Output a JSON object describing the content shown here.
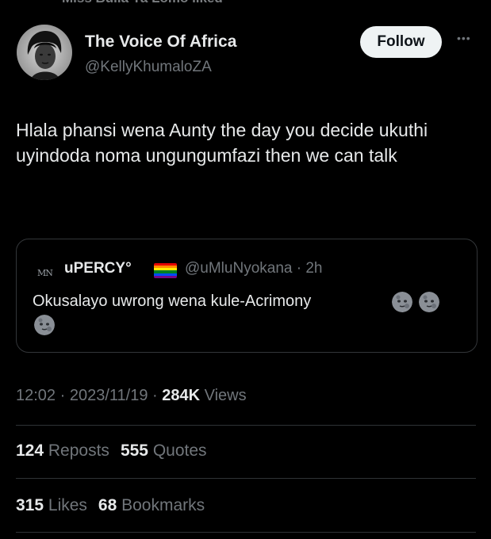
{
  "top_cutoff_text": "Miss Bulla Ya Lomo liked",
  "author": {
    "name": "The Voice Of Africa",
    "handle": "@KellyKhumaloZA",
    "follow_label": "Follow",
    "more_icon": "more-icon"
  },
  "tweet": {
    "text": "Hlala phansi wena Aunty the day you decide ukuthi uyindoda noma ungungumfazi then we can talk"
  },
  "quoted": {
    "logo_text": "MN",
    "name": "uPERCY°",
    "flag_icon": "rainbow-flag-icon",
    "handle_time": "@uMluNyokana · 2h",
    "text": "Okusalayo uwrong wena kule-Acrimony",
    "emoji_icon": "new-moon-face-icon"
  },
  "meta": {
    "time_date": "12:02 · 2023/11/19 ·",
    "views_count": "284K",
    "views_label": "Views"
  },
  "stats": {
    "reposts_count": "124",
    "reposts_label": "Reposts",
    "quotes_count": "555",
    "quotes_label": "Quotes",
    "likes_count": "315",
    "likes_label": "Likes",
    "bookmarks_count": "68",
    "bookmarks_label": "Bookmarks"
  },
  "colors": {
    "background": "#000000",
    "text": "#e7e9ea",
    "secondary": "#71767b",
    "divider": "#2f3336",
    "follow_bg": "#eff3f4"
  }
}
